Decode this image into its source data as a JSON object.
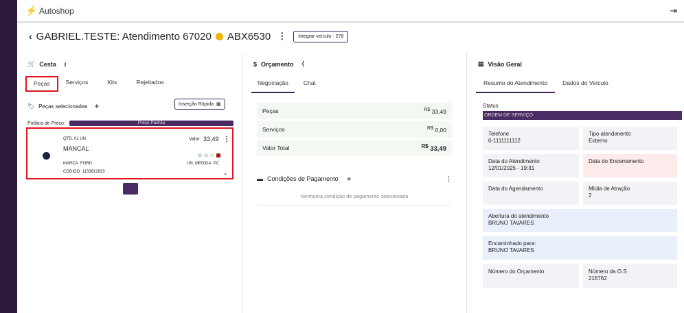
{
  "app": {
    "title": "Autoshop"
  },
  "header": {
    "title": "GABRIEL.TESTE: Atendimento 67020",
    "plate": "ABX6530",
    "integrate_button": "Integrar veículo - 278",
    "status_color": "#f0b400"
  },
  "cesta": {
    "title": "Cesta",
    "tabs": [
      {
        "label": "Peças",
        "active": true
      },
      {
        "label": "Serviços"
      },
      {
        "label": "Kits"
      },
      {
        "label": "Rejeitados"
      }
    ],
    "selected_label": "Peças selecionadas",
    "quick_insert": "Inserção Rápida",
    "policy_label": "Política de Preço:",
    "policy_value": "Preço Padrão",
    "part": {
      "qty": "QTD. 01 UN",
      "name": "MANCAL",
      "value_label": "Valor",
      "value": "33,49",
      "brand_label": "MARCA",
      "brand": "FORD",
      "code_label": "CÓDIGO",
      "code": "1133612833",
      "unit_label": "UN. MEDIDA",
      "unit": "PC"
    }
  },
  "orcamento": {
    "title": "Orçamento",
    "tabs": [
      {
        "label": "Negociação",
        "active": true
      },
      {
        "label": "Chat"
      }
    ],
    "rows": [
      {
        "label": "Peças",
        "currency": "R$",
        "value": "33,49"
      },
      {
        "label": "Serviços",
        "currency": "R$",
        "value": "0,00"
      },
      {
        "label": "Valor Total",
        "currency": "R$",
        "value": "33,49"
      }
    ],
    "payment_title": "Condições de Pagamento",
    "payment_empty": "Nenhuma condição de pagamento selecionada"
  },
  "visao": {
    "title": "Visão Geral",
    "tabs": [
      {
        "label": "Resumo do Atendimento",
        "active": true
      },
      {
        "label": "Dados do Veículo"
      }
    ],
    "status_label": "Status",
    "status_value": "ORDEM DE SERVIÇO",
    "fields": {
      "telefone": {
        "label": "Telefone",
        "value": "0-1111111112"
      },
      "tipo": {
        "label": "Tipo atendimento",
        "value": "Externo"
      },
      "data_atendimento": {
        "label": "Data do Atendimento",
        "value": "12/01/2025 - 19:31"
      },
      "data_encerramento": {
        "label": "Data do Encerramento",
        "value": ""
      },
      "data_agendamento": {
        "label": "Data do Agendamento",
        "value": ""
      },
      "midia": {
        "label": "Mídia de Atração",
        "value": "2"
      },
      "abertura": {
        "label": "Abertura do atendimento",
        "value": "BRUNO TAVARES"
      },
      "encaminhado": {
        "label": "Encaminhado para:",
        "value": "BRUNO TAVARES"
      },
      "numero_orcamento": {
        "label": "Número do Orçamento",
        "value": ""
      },
      "numero_os": {
        "label": "Número da O.S",
        "value": "216762"
      }
    }
  }
}
